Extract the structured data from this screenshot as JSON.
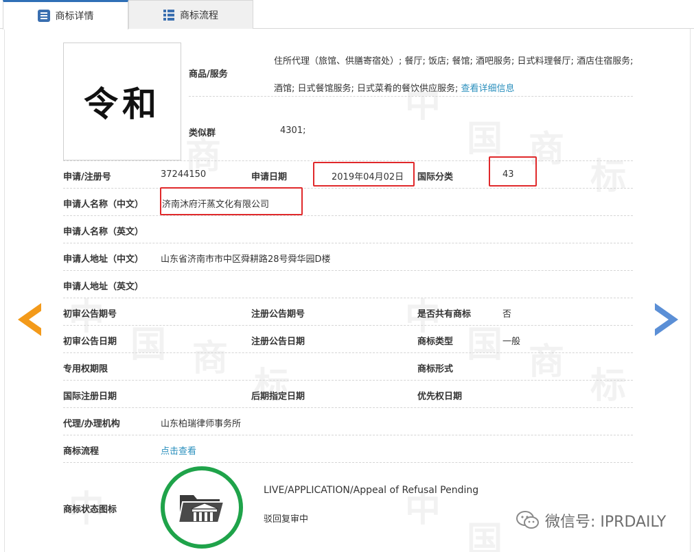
{
  "tabs": [
    {
      "label": "商标详情",
      "icon": "list-icon",
      "active": true
    },
    {
      "label": "商标流程",
      "icon": "grid-icon",
      "active": false
    }
  ],
  "watermark": [
    "中",
    "国",
    "商",
    "标"
  ],
  "mark": {
    "image_text": "令和"
  },
  "goods": {
    "label": "商品/服务",
    "text": "住所代理（旅馆、供膳寄宿处）; 餐厅; 饭店; 餐馆; 酒吧服务; 日式料理餐厅; 酒店住宿服务; 酒馆; 日式餐馆服务; 日式菜肴的餐饮供应服务;",
    "more_link": "查看详细信息"
  },
  "similar_group": {
    "label": "类似群",
    "value": "4301;"
  },
  "fields": {
    "reg_no": {
      "label": "申请/注册号",
      "value": "37244150"
    },
    "apply_date": {
      "label": "申请日期",
      "value": "2019年04月02日"
    },
    "intl_class": {
      "label": "国际分类",
      "value": "43"
    },
    "applicant_cn": {
      "label": "申请人名称（中文）",
      "value": "济南沐府汗蒸文化有限公司"
    },
    "applicant_en": {
      "label": "申请人名称（英文）",
      "value": ""
    },
    "address_cn": {
      "label": "申请人地址（中文）",
      "value": "山东省济南市市中区舜耕路28号舜华园D楼"
    },
    "address_en": {
      "label": "申请人地址（英文）",
      "value": ""
    },
    "prelim_pub_no": {
      "label": "初审公告期号",
      "value": ""
    },
    "reg_pub_no": {
      "label": "注册公告期号",
      "value": ""
    },
    "shared": {
      "label": "是否共有商标",
      "value": "否"
    },
    "prelim_pub_date": {
      "label": "初审公告日期",
      "value": ""
    },
    "reg_pub_date": {
      "label": "注册公告日期",
      "value": ""
    },
    "mark_type": {
      "label": "商标类型",
      "value": "一般"
    },
    "exclusive_period": {
      "label": "专用权期限",
      "value": ""
    },
    "mark_form": {
      "label": "商标形式",
      "value": ""
    },
    "intl_reg_date": {
      "label": "国际注册日期",
      "value": ""
    },
    "later_designation": {
      "label": "后期指定日期",
      "value": ""
    },
    "priority_date": {
      "label": "优先权日期",
      "value": ""
    },
    "agent": {
      "label": "代理/办理机构",
      "value": "山东柏瑞律师事务所"
    },
    "process": {
      "label": "商标流程",
      "value": "点击查看"
    },
    "status_icon": {
      "label": "商标状态图标"
    }
  },
  "status": {
    "en": "LIVE/APPLICATION/Appeal of Refusal Pending",
    "cn": "驳回复审中",
    "ring_color": "#1fa34a"
  },
  "wechat": {
    "text": "微信号: IPRDAILY"
  },
  "colors": {
    "highlight": "#e0282a",
    "link": "#2a8fbd",
    "arrow_left": "#f39a1a",
    "arrow_right": "#5b8fd6"
  }
}
